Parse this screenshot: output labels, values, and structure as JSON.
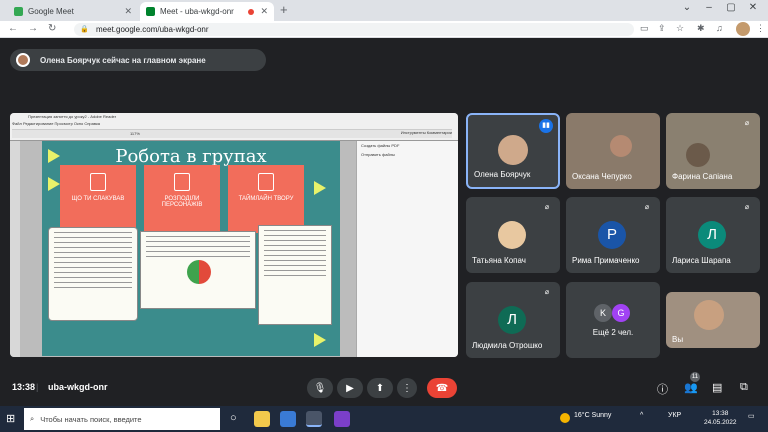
{
  "browser": {
    "tabs": [
      {
        "label": "Google Meet",
        "active": false
      },
      {
        "label": "Meet - uba-wkgd-onr",
        "active": true
      }
    ],
    "url": "meet.google.com/uba-wkgd-onr"
  },
  "banner": {
    "text": "Олена Боярчук сейчас на главном экране"
  },
  "slide": {
    "title": "Робота в групах",
    "cards": [
      "ЩО ТИ СЛАКУВАВ",
      "РОЗПОДІЛИ ПЕРСОНАЖІВ",
      "ТАЙМЛАЙН ТВОРУ"
    ],
    "side_items": [
      "Создать файлы PDF",
      "Отправить файлы"
    ],
    "app_menu": "Файл  Редактирование  Просмотр  Окно  Справка",
    "app_title": "Презентация заняття до уроку2 - Adobe Reader",
    "toolbar_right": "Инструменты   Комментарии",
    "zoom": "117%"
  },
  "participants": [
    {
      "name": "Олена Боярчук",
      "speaking": true,
      "initial": "",
      "color": "#3c4043"
    },
    {
      "name": "Оксана Чепурко",
      "speaking": false,
      "initial": "",
      "color": "#8a7a6a"
    },
    {
      "name": "Фарина Сапіана",
      "speaking": false,
      "initial": "",
      "color": "#8a8070"
    },
    {
      "name": "Татьяна Копач",
      "speaking": false,
      "initial": "",
      "color": "#3c4043"
    },
    {
      "name": "Рима Примаченко",
      "speaking": false,
      "initial": "Р",
      "color": "#1a55a8"
    },
    {
      "name": "Лариса Шарапа",
      "speaking": false,
      "initial": "Л",
      "color": "#0b8a7a"
    },
    {
      "name": "Людмила Отрошко",
      "speaking": false,
      "initial": "Л",
      "color": "#0f6b55"
    },
    {
      "name": "Ещё 2 чел.",
      "speaking": false,
      "initial": "",
      "color": "#3c4043"
    },
    {
      "name": "Вы",
      "speaking": false,
      "initial": "",
      "color": "#a09080"
    }
  ],
  "meeting": {
    "time": "13:38",
    "code": "uba-wkgd-onr",
    "people_count": "11"
  },
  "taskbar": {
    "search_placeholder": "Чтобы начать поиск, введите",
    "weather": "16°C  Sunny",
    "lang": "УКР",
    "clock_time": "13:38",
    "clock_date": "24.05.2022"
  },
  "colors": {
    "accent_blue": "#8ab4f8",
    "hangup_red": "#ea4335",
    "slide_teal": "#3b8c8c",
    "card_coral": "#f26d5b"
  }
}
